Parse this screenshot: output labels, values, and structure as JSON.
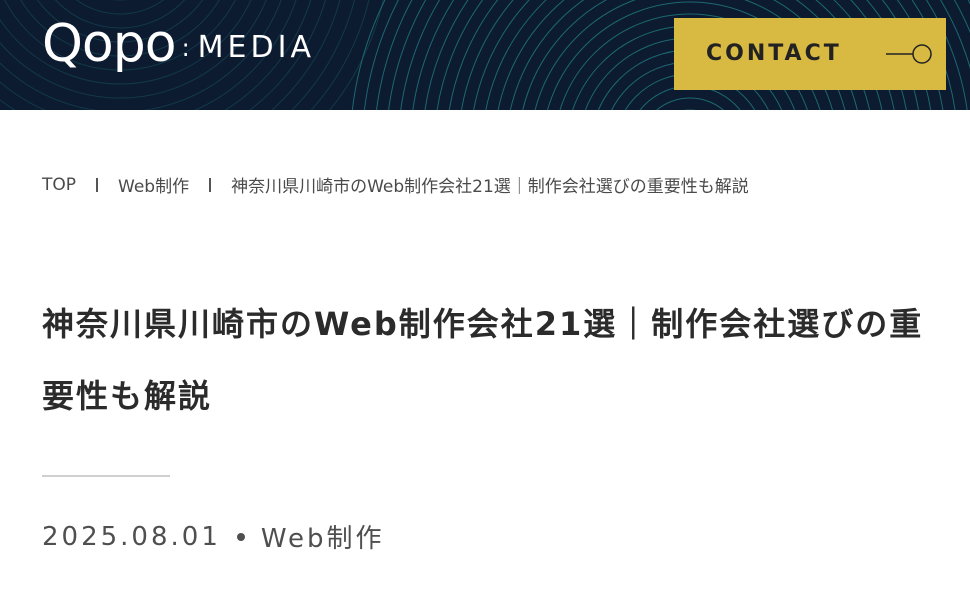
{
  "header": {
    "logo": {
      "main": "Qopo",
      "colon": ":",
      "sub": "MEDIA"
    },
    "contact": {
      "label": "CONTACT",
      "icon": "arrow-circle-icon"
    },
    "colors": {
      "background": "#0c1b30",
      "accent": "#d8b942",
      "wave": "#2aa7a3"
    }
  },
  "breadcrumb": {
    "items": [
      "TOP",
      "Web制作",
      "神奈川県川崎市のWeb制作会社21選｜制作会社選びの重要性も解説"
    ]
  },
  "article": {
    "title": "神奈川県川崎市のWeb制作会社21選｜制作会社選びの重要性も解説",
    "date": "2025.08.01",
    "category": "Web制作"
  }
}
